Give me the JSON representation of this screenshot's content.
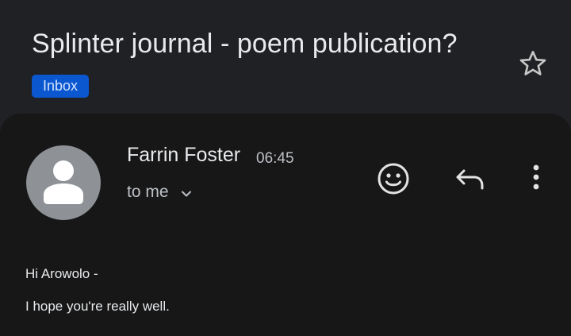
{
  "email": {
    "subject": "Splinter journal - poem publication?",
    "label": "Inbox",
    "sender_name": "Farrin Foster",
    "time": "06:45",
    "recipient_text": "to me",
    "body_lines": [
      "Hi Arowolo -",
      "I hope you're really well."
    ]
  },
  "icons": {
    "star": "star-outline-icon",
    "avatar": "person-icon",
    "expand": "chevron-down-icon",
    "emoji": "emoji-smile-icon",
    "reply": "reply-icon",
    "more": "more-vert-icon"
  },
  "colors": {
    "background": "#202124",
    "card": "#171717",
    "label_chip": "#0b57d0",
    "avatar": "#8e9196"
  }
}
